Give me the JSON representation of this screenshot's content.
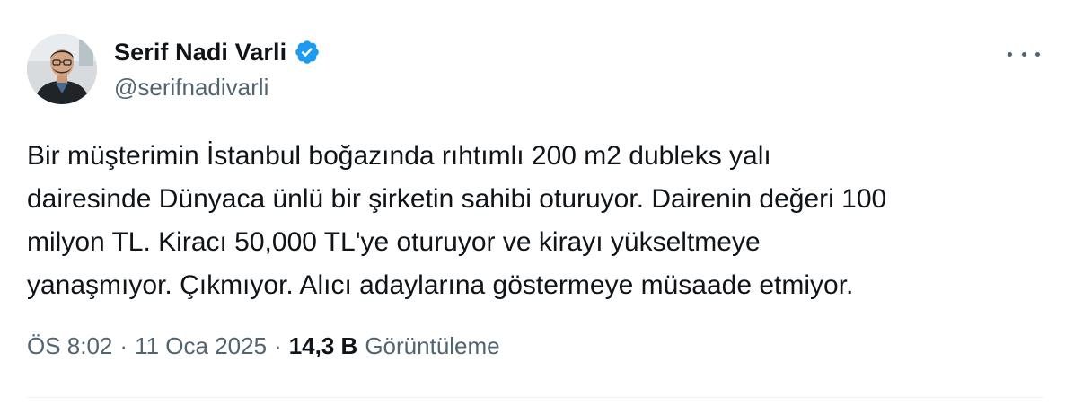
{
  "author": {
    "display_name": "Serif Nadi Varli",
    "handle": "@serifnadivarli",
    "verified": true,
    "avatar_icon": "profile-photo"
  },
  "more_icon": "more-horizontal-icon",
  "tweet": {
    "text": "Bir müşterimin İstanbul boğazında rıhtımlı 200 m2 dubleks yalı\ndairesinde Dünyaca ünlü bir şirketin sahibi oturuyor. Dairenin değeri 100\nmilyon TL. Kiracı 50,000 TL'ye oturuyor ve kirayı yükseltmeye\nyanaşmıyor. Çıkmıyor. Alıcı adaylarına göstermeye müsaade etmiyor."
  },
  "meta": {
    "time": "ÖS 8:02",
    "separator": "·",
    "date": "11 Oca 2025",
    "views_count": "14,3 B",
    "views_label": "Görüntüleme"
  },
  "colors": {
    "text_primary": "#0f1419",
    "text_secondary": "#536471",
    "verified_blue": "#1d9bf0",
    "divider": "#eff3f4"
  }
}
